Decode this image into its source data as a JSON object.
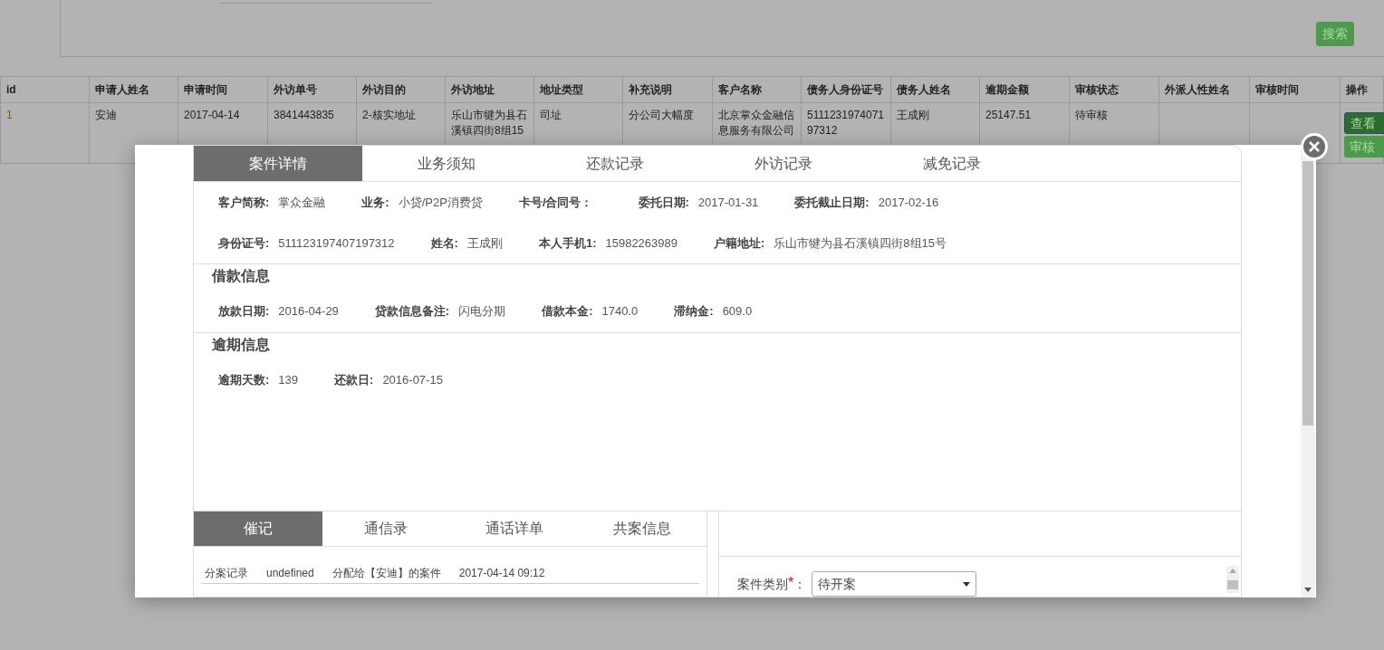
{
  "search_button": "搜索",
  "table": {
    "columns": [
      "id",
      "申请人姓名",
      "申请时间",
      "外访单号",
      "外访目的",
      "外访地址",
      "地址类型",
      "补充说明",
      "客户名称",
      "债务人身份证号",
      "债务人姓名",
      "逾期金额",
      "审核状态",
      "外派人性姓名",
      "审核时间",
      "操作"
    ],
    "rows": [
      {
        "cells": [
          "1",
          "安迪",
          "2017-04-14",
          "3841443835",
          "2-核实地址",
          "乐山市犍为县石溪镇四街8组15",
          "司址",
          "分公司大幅度",
          "北京掌众金融信息服务有限公司",
          "511123197407197312",
          "王成刚",
          "25147.51",
          "待审核",
          "",
          ""
        ],
        "actions": [
          {
            "label": "查看",
            "kind": "primary"
          },
          {
            "label": "审核",
            "kind": "plain"
          }
        ]
      }
    ]
  },
  "modal": {
    "tabs": [
      {
        "label": "案件详情",
        "selected": true
      },
      {
        "label": "业务须知",
        "selected": false
      },
      {
        "label": "还款记录",
        "selected": false
      },
      {
        "label": "外访记录",
        "selected": false
      },
      {
        "label": "减免记录",
        "selected": false
      }
    ],
    "sections": [
      {
        "fields": [
          [
            {
              "label": "客户简称:",
              "value": "掌众金融"
            },
            {
              "label": "业务:",
              "value": "小贷/P2P消费贷"
            },
            {
              "label": "卡号/合同号："
            },
            {
              "label": "委托日期:",
              "value": "2017-01-31"
            },
            {
              "label": "委托截止日期:",
              "value": "2017-02-16"
            }
          ],
          [
            {
              "label": "身份证号:",
              "value": "511123197407197312"
            },
            {
              "label": "姓名:",
              "value": "王成刚"
            },
            {
              "label": "本人手机1:",
              "value": "15982263989"
            },
            {
              "label": "户籍地址:",
              "value": "乐山市犍为县石溪镇四街8组15号"
            }
          ]
        ]
      },
      {
        "title": "借款信息",
        "fields": [
          [
            {
              "label": "放款日期:",
              "value": "2016-04-29"
            },
            {
              "label": "贷款信息备注:",
              "value": "闪电分期"
            },
            {
              "label": "借款本金:",
              "value": "1740.0"
            },
            {
              "label": "滞纳金:",
              "value": "609.0"
            }
          ]
        ]
      },
      {
        "title": "逾期信息",
        "fields": [
          [
            {
              "label": "逾期天数:",
              "value": "139"
            },
            {
              "label": "还款日:",
              "value": "2016-07-15"
            }
          ]
        ]
      }
    ],
    "bottom_tabs": [
      {
        "label": "催记",
        "selected": true
      },
      {
        "label": "通信录",
        "selected": false
      },
      {
        "label": "通话详单",
        "selected": false
      },
      {
        "label": "共案信息",
        "selected": false
      }
    ],
    "records": [
      [
        "分案记录",
        "undefined",
        "分配给【安迪】的案件",
        "2017-04-14 09:12"
      ]
    ],
    "form": {
      "label": "案件类别",
      "required_mark": "*",
      "separator": "：",
      "select_value": "待开案"
    }
  }
}
